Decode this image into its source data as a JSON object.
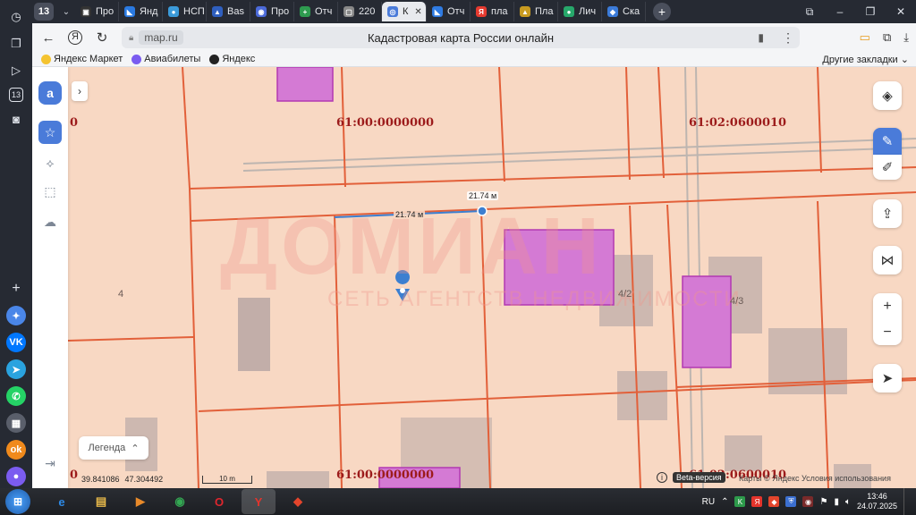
{
  "side_panel": {
    "icons": [
      "clock-icon",
      "collections-icon",
      "play-icon",
      "tab-counter-icon",
      "screenshot-icon"
    ],
    "counter": "13",
    "apps": [
      {
        "name": "alice-icon",
        "glyph": "✦",
        "color": "#4a86e8"
      },
      {
        "name": "vk-icon",
        "glyph": "VK",
        "color": "#0077ff"
      },
      {
        "name": "telegram-icon",
        "glyph": "➤",
        "color": "#2aa3df"
      },
      {
        "name": "whatsapp-icon",
        "glyph": "✆",
        "color": "#25d366"
      },
      {
        "name": "apps-icon",
        "glyph": "▦",
        "color": "#5a5f6b"
      },
      {
        "name": "ok-icon",
        "glyph": "ok",
        "color": "#f08a1c"
      },
      {
        "name": "messenger-icon",
        "glyph": "●",
        "color": "#7b5cf0"
      }
    ]
  },
  "tabs": {
    "counter": "13",
    "items": [
      {
        "label": "Про",
        "fav": "#333",
        "glyph": "▣"
      },
      {
        "label": "Янд",
        "fav": "#2a7ae2",
        "glyph": "◣"
      },
      {
        "label": "НСП",
        "fav": "#3b9ad9",
        "glyph": "●"
      },
      {
        "label": "Bas",
        "fav": "#2f5fbf",
        "glyph": "▲"
      },
      {
        "label": "Про",
        "fav": "#4b6ad9",
        "glyph": "◉"
      },
      {
        "label": "Отч",
        "fav": "#2e9b4f",
        "glyph": "+"
      },
      {
        "label": "220",
        "fav": "#888",
        "glyph": "▢"
      },
      {
        "label": "К",
        "fav": "#4a7bd9",
        "glyph": "◎",
        "active": true
      },
      {
        "label": "Отч",
        "fav": "#2f7be2",
        "glyph": "◣"
      },
      {
        "label": "пла",
        "fav": "#e53a2f",
        "glyph": "Я"
      },
      {
        "label": "Пла",
        "fav": "#c89a20",
        "glyph": "▲"
      },
      {
        "label": "Лич",
        "fav": "#27a86b",
        "glyph": "●"
      },
      {
        "label": "Ска",
        "fav": "#3b7bd9",
        "glyph": "◆"
      }
    ]
  },
  "address": {
    "domain": "map.ru",
    "page_title": "Кадастровая карта России онлайн"
  },
  "bookmarks": {
    "items": [
      {
        "label": "Яндекс Маркет",
        "color": "#f4c330"
      },
      {
        "label": "Авиабилеты",
        "color": "#7a5cf0"
      },
      {
        "label": "Яндекс",
        "color": "#222"
      }
    ],
    "other": "Другие закладки"
  },
  "map": {
    "watermark_main": "ДОМИАН",
    "watermark_sub": "СЕТЬ АГЕНТСТВ НЕДВИЖИМОСТИ",
    "cadastral_labels": [
      "61:00:0000000",
      "61:02:0600010",
      "61:00:0000000",
      "61:02:0600010"
    ],
    "left_edge_digit": "0",
    "plot_numbers": [
      "4",
      "4/2",
      "4/3"
    ],
    "ruler_label": "21.74 м",
    "ruler_inline": "21.74 м",
    "legend": "Легенда",
    "coords": {
      "lon": "39.841086",
      "lat": "47.304492"
    },
    "scale": "10 m",
    "beta": "Beta-версия",
    "attribution": "Карты © Яндекс   Условия использования"
  },
  "taskbar": {
    "apps": [
      {
        "name": "ie-icon",
        "glyph": "e",
        "color": "#2d8ae6"
      },
      {
        "name": "explorer-icon",
        "glyph": "▤",
        "color": "#e6b84a"
      },
      {
        "name": "media-icon",
        "glyph": "▶",
        "color": "#e88a2a"
      },
      {
        "name": "chrome-icon",
        "glyph": "◉",
        "color": "#34a853"
      },
      {
        "name": "opera-icon",
        "glyph": "O",
        "color": "#e0262e"
      },
      {
        "name": "yandex-browser-icon",
        "glyph": "Y",
        "color": "#e4342c",
        "active": true
      },
      {
        "name": "anydesk-icon",
        "glyph": "◆",
        "color": "#e4452c"
      }
    ],
    "lang": "RU",
    "time": "13:46",
    "date": "24.07.2025"
  }
}
